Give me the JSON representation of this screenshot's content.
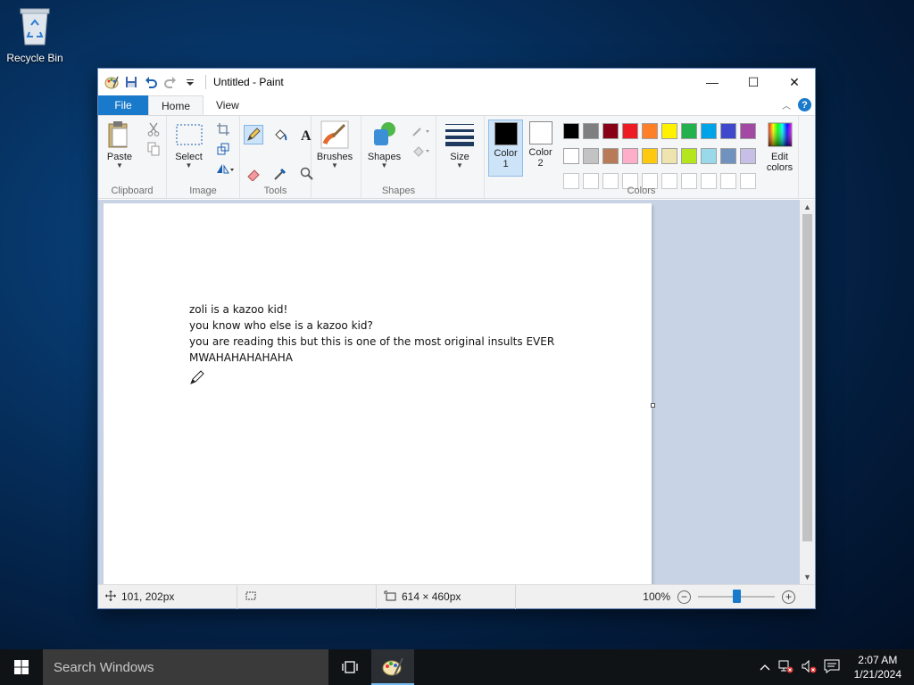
{
  "desktop": {
    "recycle_bin_label": "Recycle Bin"
  },
  "window": {
    "title": "Untitled - Paint",
    "controls": {
      "minimize": "—",
      "maximize": "☐",
      "close": "✕"
    }
  },
  "tabs": [
    {
      "label": "File"
    },
    {
      "label": "Home"
    },
    {
      "label": "View"
    }
  ],
  "ribbon": {
    "clipboard": {
      "paste_label": "Paste",
      "group_label": "Clipboard"
    },
    "image": {
      "select_label": "Select",
      "group_label": "Image"
    },
    "tools": {
      "group_label": "Tools"
    },
    "brushes": {
      "label": "Brushes"
    },
    "shapes": {
      "label": "Shapes",
      "group_label": "Shapes"
    },
    "size": {
      "label": "Size"
    },
    "color1": {
      "label_line1": "Color",
      "label_line2": "1",
      "value": "#000000"
    },
    "color2": {
      "label_line1": "Color",
      "label_line2": "2",
      "value": "#ffffff"
    },
    "edit_colors": {
      "label_line1": "Edit",
      "label_line2": "colors"
    },
    "colors_group_label": "Colors",
    "palette": [
      "#000000",
      "#7f7f7f",
      "#880015",
      "#ed1c24",
      "#ff7f27",
      "#fff200",
      "#22b14c",
      "#00a2e8",
      "#3f48cc",
      "#a349a4",
      "#ffffff",
      "#c3c3c3",
      "#b97a57",
      "#ffaec9",
      "#ffc90e",
      "#efe4b0",
      "#b5e61d",
      "#99d9ea",
      "#7092be",
      "#c8bfe7",
      "#ffffff",
      "#ffffff",
      "#ffffff",
      "#ffffff",
      "#ffffff",
      "#ffffff",
      "#ffffff",
      "#ffffff",
      "#ffffff",
      "#ffffff"
    ]
  },
  "canvas": {
    "lines": [
      "zoli is a kazoo kid!",
      "you know who else is a kazoo kid?",
      "you are reading this but this is one of the most original insults EVER",
      "MWAHAHAHAHAHA"
    ]
  },
  "statusbar": {
    "cursor_position": "101, 202px",
    "selection_size": "",
    "image_size": "614 × 460px",
    "zoom_level": "100%",
    "zoom_fraction": 0.5
  },
  "taskbar": {
    "search_placeholder": "Search Windows",
    "time": "2:07 AM",
    "date": "1/21/2024"
  }
}
